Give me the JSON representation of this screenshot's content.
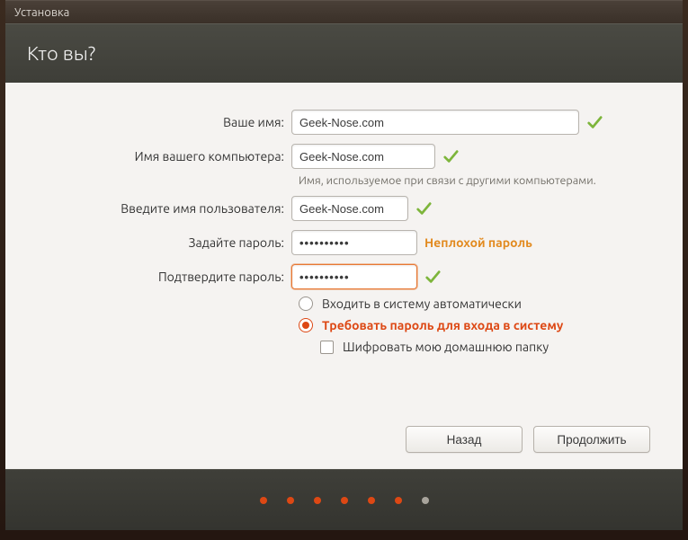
{
  "window": {
    "title": "Установка"
  },
  "header": {
    "title": "Кто вы?"
  },
  "form": {
    "name": {
      "label": "Ваше имя:",
      "value": "Geek-Nose.com"
    },
    "hostname": {
      "label": "Имя вашего компьютера:",
      "value": "Geek-Nose.com",
      "hint": "Имя, используемое при связи с другими компьютерами."
    },
    "username": {
      "label": "Введите имя пользователя:",
      "value": "Geek-Nose.com"
    },
    "password": {
      "label": "Задайте пароль:",
      "value": "••••••••••",
      "strength": "Неплохой пароль"
    },
    "confirm": {
      "label": "Подтвердите пароль:",
      "value": "••••••••••"
    },
    "radio_auto": "Входить в систему автоматически",
    "radio_require": "Требовать пароль для входа в систему",
    "encrypt_home": "Шифровать мою домашнюю папку"
  },
  "buttons": {
    "back": "Назад",
    "continue": "Продолжить"
  },
  "progress": {
    "total": 7,
    "current": 6
  },
  "colors": {
    "accent": "#dd4814",
    "strength": "#e28a1f",
    "check": "#7db53b"
  }
}
